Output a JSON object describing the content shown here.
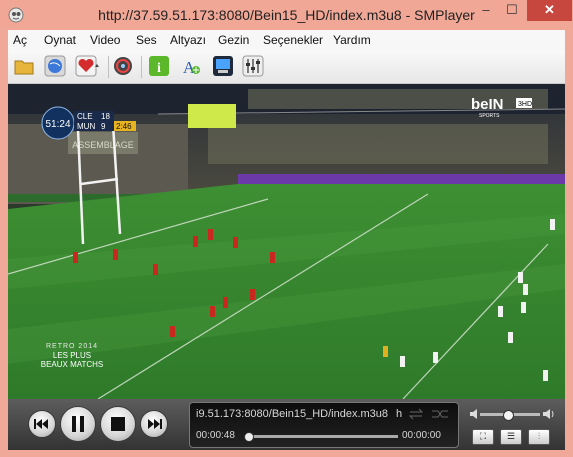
{
  "window": {
    "title": "http://37.59.51.173:8080/Bein15_HD/index.m3u8 - SMPlayer",
    "min_glyph": "–",
    "max_glyph": "☐",
    "close_glyph": "✕"
  },
  "menu": [
    "Aç",
    "Oynat",
    "Video",
    "Ses",
    "Altyazı",
    "Gezin",
    "Seçenekler",
    "Yardım"
  ],
  "toolbar_icons": [
    "open-folder-icon",
    "globe-icon",
    "favorites-heart-icon",
    "disc-icon",
    "info-icon",
    "font-icon",
    "screenshot-icon",
    "equalizer-icon"
  ],
  "video": {
    "scoreboard": {
      "clock": "51:24",
      "team1": "CLE",
      "score1": "18",
      "team2": "MUN",
      "score2": "9",
      "extra": "2:46"
    },
    "channel_logo": "beIN",
    "channel_sub": "SPORTS",
    "hd_badge": "3HD",
    "overlay_line1": "RETRO 2014",
    "overlay_line2": "LES PLUS",
    "overlay_line3": "BEAUX MATCHS",
    "stadium_text": "ASSEMBLAGE"
  },
  "controls": {
    "source": "i9.51.173:8080/Bein15_HD/index.m3u8",
    "source_suffix": "h",
    "elapsed": "00:00:48",
    "total": "00:00:00",
    "progress": 0.0,
    "volume": 0.45
  },
  "colors": {
    "frame": "#f0a999",
    "close": "#c7463d",
    "pitch": "#3f8f36"
  }
}
